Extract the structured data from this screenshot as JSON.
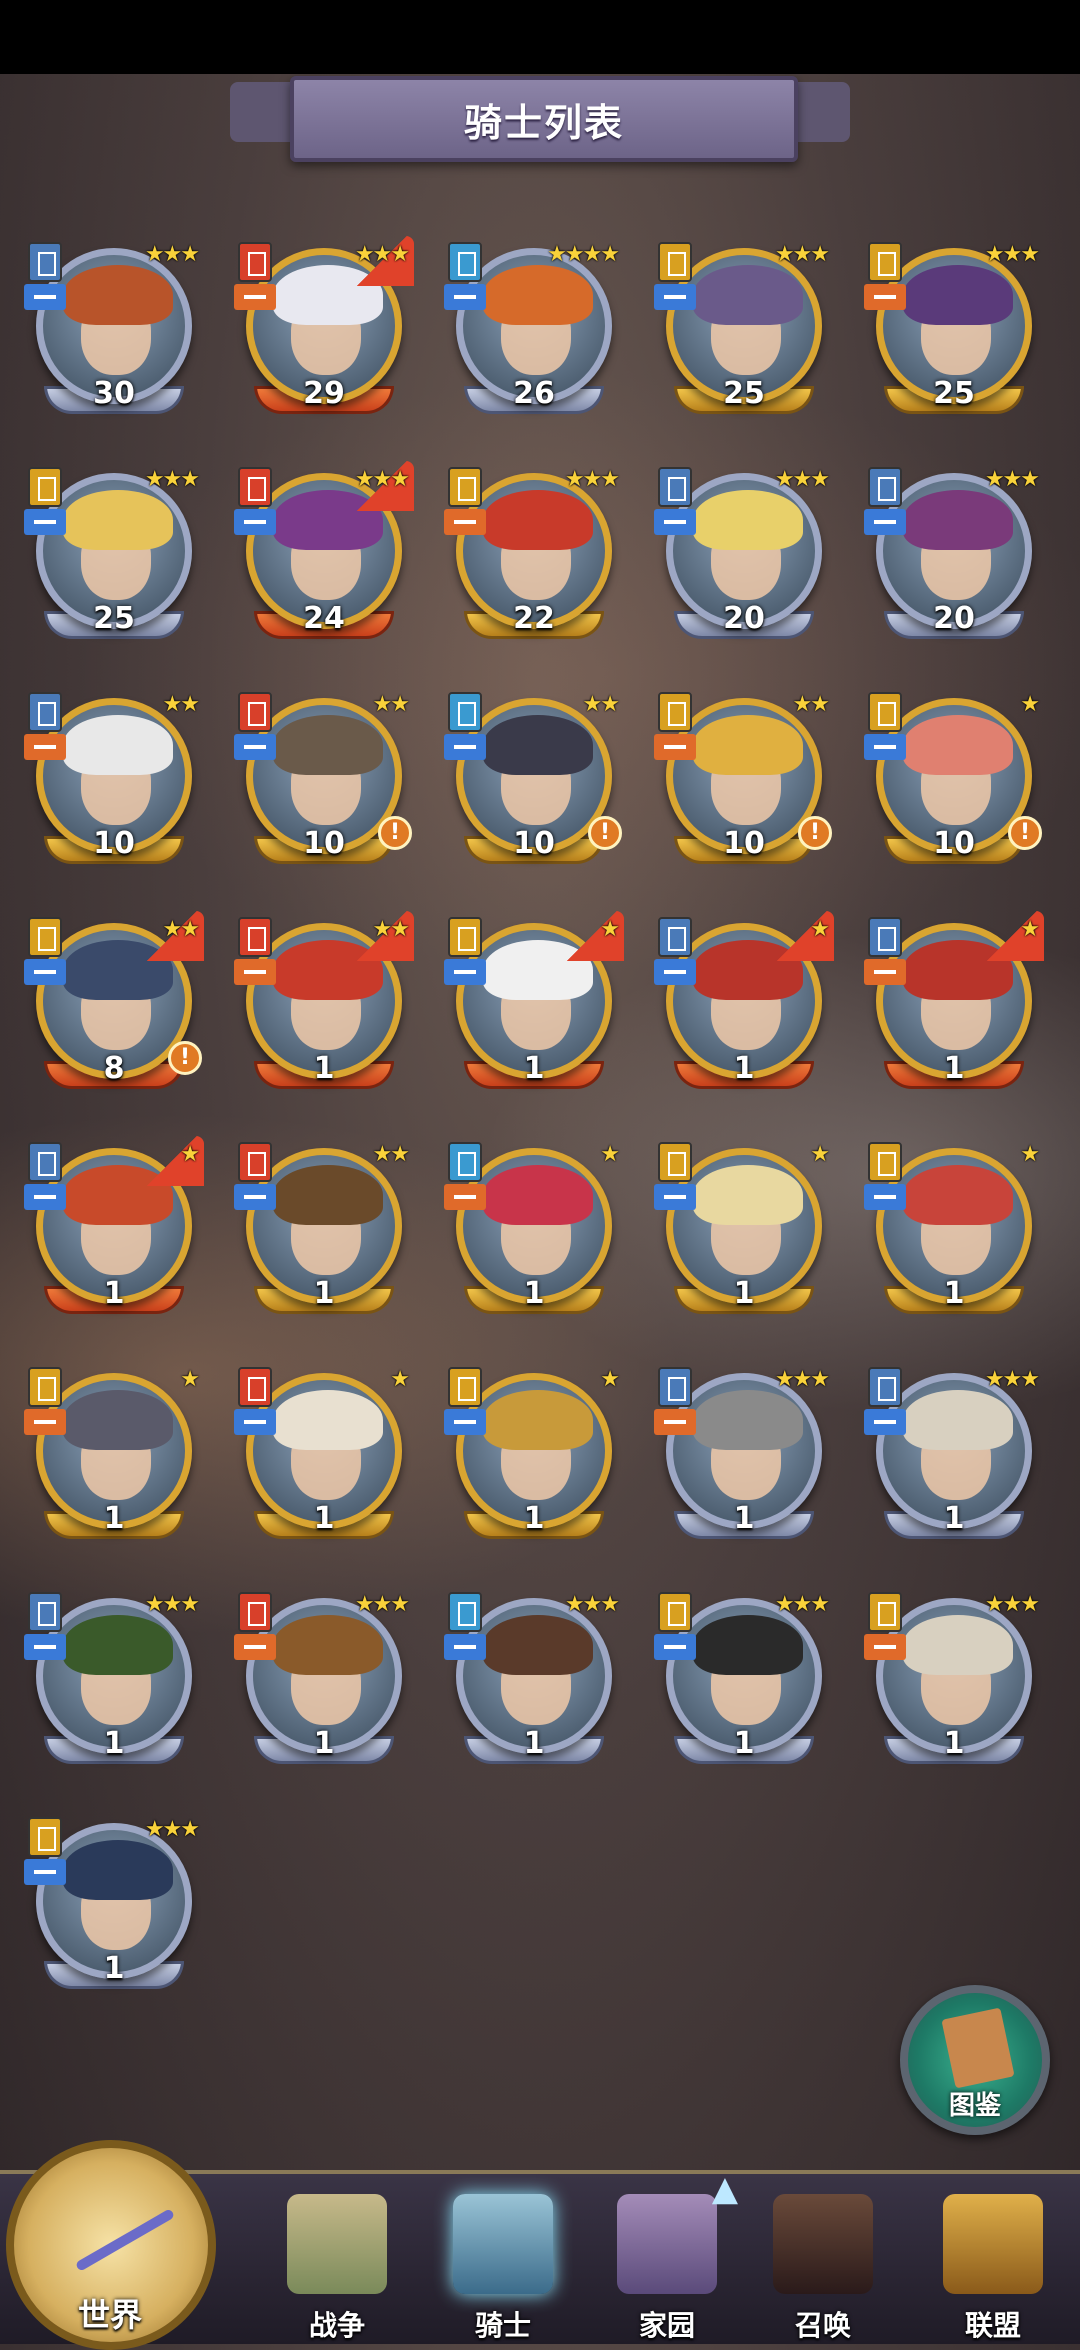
{
  "header": {
    "title": "骑士列表"
  },
  "knights": [
    {
      "level": "30",
      "stars": "★★★",
      "frame": "silver",
      "alert": false,
      "flag": false
    },
    {
      "level": "29",
      "stars": "★★★",
      "frame": "redbar",
      "alert": false,
      "flag": true
    },
    {
      "level": "26",
      "stars": "★★★★",
      "frame": "silver",
      "alert": false,
      "flag": false
    },
    {
      "level": "25",
      "stars": "★★★",
      "frame": "gold",
      "alert": false,
      "flag": false
    },
    {
      "level": "25",
      "stars": "★★★",
      "frame": "gold",
      "alert": false,
      "flag": false
    },
    {
      "level": "25",
      "stars": "★★★",
      "frame": "silver",
      "alert": false,
      "flag": false
    },
    {
      "level": "24",
      "stars": "★★★",
      "frame": "redbar",
      "alert": false,
      "flag": true
    },
    {
      "level": "22",
      "stars": "★★★",
      "frame": "gold",
      "alert": false,
      "flag": false
    },
    {
      "level": "20",
      "stars": "★★★",
      "frame": "silver",
      "alert": false,
      "flag": false
    },
    {
      "level": "20",
      "stars": "★★★",
      "frame": "silver",
      "alert": false,
      "flag": false
    },
    {
      "level": "10",
      "stars": "★★",
      "frame": "gold",
      "alert": false,
      "flag": false
    },
    {
      "level": "10",
      "stars": "★★",
      "frame": "gold",
      "alert": true,
      "flag": false
    },
    {
      "level": "10",
      "stars": "★★",
      "frame": "gold",
      "alert": true,
      "flag": false
    },
    {
      "level": "10",
      "stars": "★★",
      "frame": "gold",
      "alert": true,
      "flag": false
    },
    {
      "level": "10",
      "stars": "★",
      "frame": "gold",
      "alert": true,
      "flag": false
    },
    {
      "level": "8",
      "stars": "★★",
      "frame": "redbar",
      "alert": true,
      "flag": true
    },
    {
      "level": "1",
      "stars": "★★",
      "frame": "redbar",
      "alert": false,
      "flag": true
    },
    {
      "level": "1",
      "stars": "★",
      "frame": "redbar",
      "alert": false,
      "flag": true
    },
    {
      "level": "1",
      "stars": "★",
      "frame": "redbar",
      "alert": false,
      "flag": true
    },
    {
      "level": "1",
      "stars": "★",
      "frame": "redbar",
      "alert": false,
      "flag": true
    },
    {
      "level": "1",
      "stars": "★",
      "frame": "redbar",
      "alert": false,
      "flag": true
    },
    {
      "level": "1",
      "stars": "★★",
      "frame": "gold",
      "alert": false,
      "flag": false
    },
    {
      "level": "1",
      "stars": "★",
      "frame": "gold",
      "alert": false,
      "flag": false
    },
    {
      "level": "1",
      "stars": "★",
      "frame": "gold",
      "alert": false,
      "flag": false
    },
    {
      "level": "1",
      "stars": "★",
      "frame": "gold",
      "alert": false,
      "flag": false
    },
    {
      "level": "1",
      "stars": "★",
      "frame": "gold",
      "alert": false,
      "flag": false
    },
    {
      "level": "1",
      "stars": "★",
      "frame": "gold",
      "alert": false,
      "flag": false
    },
    {
      "level": "1",
      "stars": "★",
      "frame": "gold",
      "alert": false,
      "flag": false
    },
    {
      "level": "1",
      "stars": "★★★",
      "frame": "silver",
      "alert": false,
      "flag": false
    },
    {
      "level": "1",
      "stars": "★★★",
      "frame": "silver",
      "alert": false,
      "flag": false
    },
    {
      "level": "1",
      "stars": "★★★",
      "frame": "silver",
      "alert": false,
      "flag": false
    },
    {
      "level": "1",
      "stars": "★★★",
      "frame": "silver",
      "alert": false,
      "flag": false
    },
    {
      "level": "1",
      "stars": "★★★",
      "frame": "silver",
      "alert": false,
      "flag": false
    },
    {
      "level": "1",
      "stars": "★★★",
      "frame": "silver",
      "alert": false,
      "flag": false
    },
    {
      "level": "1",
      "stars": "★★★",
      "frame": "silver",
      "alert": false,
      "flag": false
    },
    {
      "level": "1",
      "stars": "★★★",
      "frame": "silver",
      "alert": false,
      "flag": false
    }
  ],
  "codex": {
    "label": "图鉴"
  },
  "nav": {
    "world": "世界",
    "battle": "战争",
    "knights": "骑士",
    "home": "家园",
    "summon": "召唤",
    "alliance": "联盟"
  },
  "colors": {
    "gold_frame": "#d9a531",
    "silver_frame": "#9da7c4",
    "alert": "#e07a24",
    "active_glow": "#8fe8ff"
  }
}
